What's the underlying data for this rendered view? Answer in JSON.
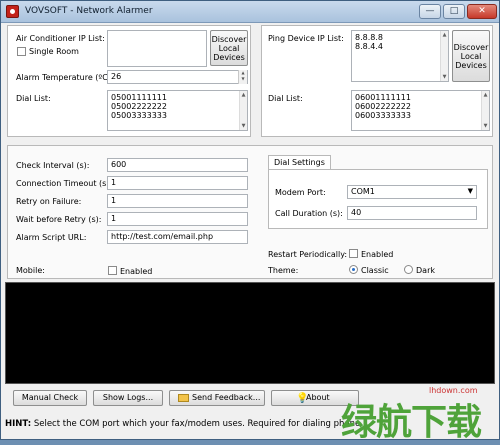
{
  "window": {
    "title": "VOVSOFT - Network Alarmer",
    "controls": {
      "minimize": "—",
      "maximize": "□",
      "close": "✕"
    }
  },
  "left_panel": {
    "ac_ip_label": "Air Conditioner IP List:",
    "single_room_label": "Single Room",
    "single_room_checked": false,
    "discover_button": "Discover\nLocal\nDevices",
    "alarm_temp_label": "Alarm Temperature (ºC):",
    "alarm_temp_value": "26",
    "dial_list_label": "Dial List:",
    "dial_list": [
      "05001111111",
      "05002222222",
      "05003333333"
    ]
  },
  "right_panel": {
    "ping_ip_label": "Ping Device IP List:",
    "ping_ips": [
      "8.8.8.8",
      "8.8.4.4"
    ],
    "discover_button": "Discover\nLocal\nDevices",
    "dial_list_label": "Dial List:",
    "dial_list": [
      "06001111111",
      "06002222222",
      "06003333333"
    ]
  },
  "settings": {
    "check_interval_label": "Check Interval (s):",
    "check_interval_value": "600",
    "conn_timeout_label": "Connection Timeout (s):",
    "conn_timeout_value": "1",
    "retry_label": "Retry on Failure:",
    "retry_value": "1",
    "wait_retry_label": "Wait before Retry (s):",
    "wait_retry_value": "1",
    "alarm_script_label": "Alarm Script URL:",
    "alarm_script_value": "http://test.com/email.php",
    "mobile_label": "Mobile:",
    "mobile_enabled_label": "Enabled",
    "mobile_enabled_checked": false
  },
  "dial_settings": {
    "tab_label": "Dial Settings",
    "modem_port_label": "Modem Port:",
    "modem_port_value": "COM1",
    "call_duration_label": "Call Duration (s):",
    "call_duration_value": "40"
  },
  "periodic": {
    "restart_label": "Restart Periodically:",
    "restart_enabled_label": "Enabled",
    "restart_checked": false,
    "theme_label": "Theme:",
    "theme_options": [
      "Classic",
      "Dark"
    ],
    "theme_selected": "Classic"
  },
  "buttons": {
    "manual_check": "Manual Check",
    "show_logs": "Show Logs...",
    "send_feedback": "Send Feedback...",
    "about": "About"
  },
  "hint": {
    "prefix": "HINT:",
    "text": "Select the COM port which your fax/modem uses. Required for dialing phone"
  },
  "watermark": {
    "site": "lhdown.com",
    "brand": "绿航下载"
  }
}
